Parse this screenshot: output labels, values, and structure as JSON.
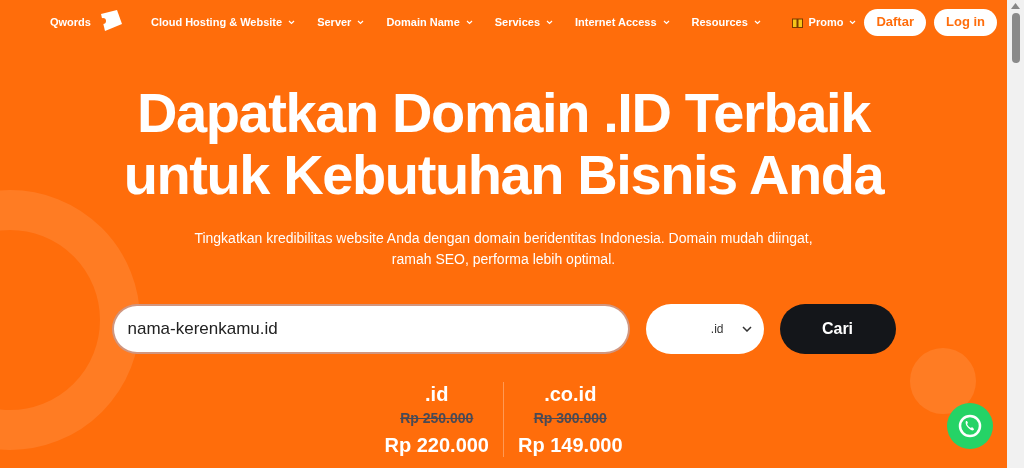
{
  "logo": {
    "text": "Qwords"
  },
  "nav": [
    {
      "label": "Cloud Hosting & Website"
    },
    {
      "label": "Server"
    },
    {
      "label": "Domain Name"
    },
    {
      "label": "Services"
    },
    {
      "label": "Internet Access"
    },
    {
      "label": "Resources"
    },
    {
      "label": "Promo"
    }
  ],
  "actions": [
    "Daftar",
    "Log in"
  ],
  "hero": {
    "title": "Dapatkan Domain .ID Terbaik untuk Kebutuhan Bisnis Anda",
    "subtitle": "Tingkatkan kredibilitas website Anda dengan domain beridentitas Indonesia. Domain mudah diingat, ramah SEO, performa lebih optimal."
  },
  "search": {
    "value": "nama-kerenkamu.id",
    "extension": ".id",
    "button": "Cari"
  },
  "prices": [
    {
      "ext": ".id",
      "old_price": "Rp 250.000",
      "price": "Rp 220.000"
    },
    {
      "ext": ".co.id",
      "old_price": "Rp 300.000",
      "price": "Rp 149.000"
    }
  ]
}
